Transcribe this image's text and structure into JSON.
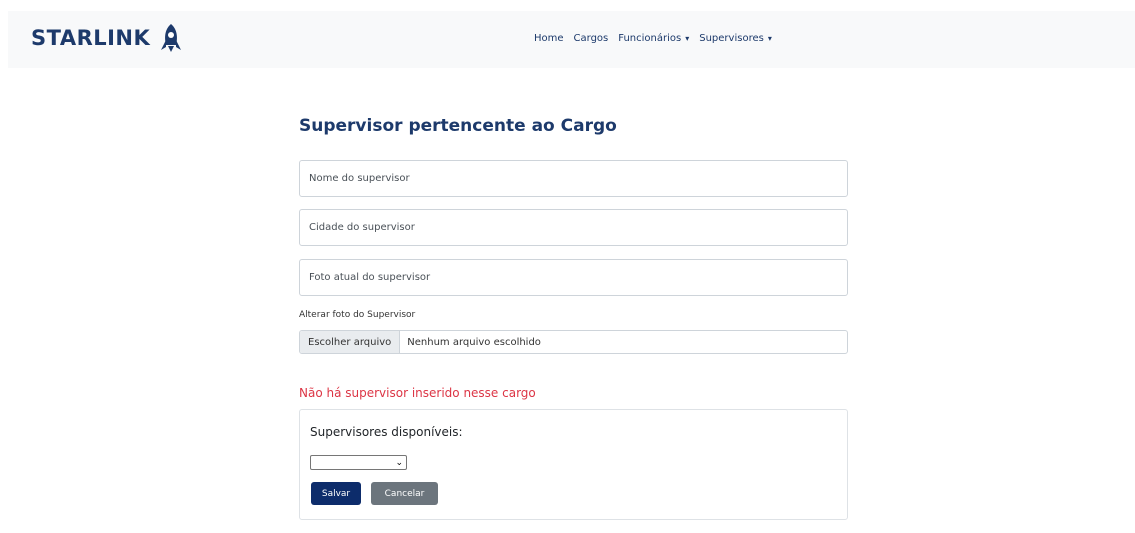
{
  "navbar": {
    "brand": "STARLINK",
    "logo_icon": "rocket-icon",
    "links": [
      {
        "label": "Home"
      },
      {
        "label": "Cargos"
      },
      {
        "label": "Funcionários",
        "dropdown": true
      },
      {
        "label": "Supervisores",
        "dropdown": true
      }
    ],
    "dropdown_caret": "▾"
  },
  "form": {
    "title": "Supervisor pertencente ao Cargo",
    "fields": {
      "nome": {
        "placeholder": "Nome do supervisor",
        "value": ""
      },
      "cidade": {
        "placeholder": "Cidade do supervisor",
        "value": ""
      },
      "foto_atual": {
        "placeholder": "Foto atual do supervisor",
        "value": ""
      }
    },
    "change_photo_label": "Alterar foto do Supervisor",
    "file_input": {
      "button_label": "Escolher arquivo",
      "status": "Nenhum arquivo escolhido"
    }
  },
  "assign": {
    "alert": "Não há supervisor inserido nesse cargo",
    "label": "Supervisores disponíveis:",
    "select_value": "",
    "select_arrow": "⌄",
    "save_label": "Salvar",
    "cancel_label": "Cancelar"
  },
  "colors": {
    "brand": "#1d3a6b",
    "alert": "#dc3545",
    "primary_button": "#0d2c6b",
    "secondary_button": "#6c757d",
    "navbar_bg": "#f8f9fa"
  }
}
